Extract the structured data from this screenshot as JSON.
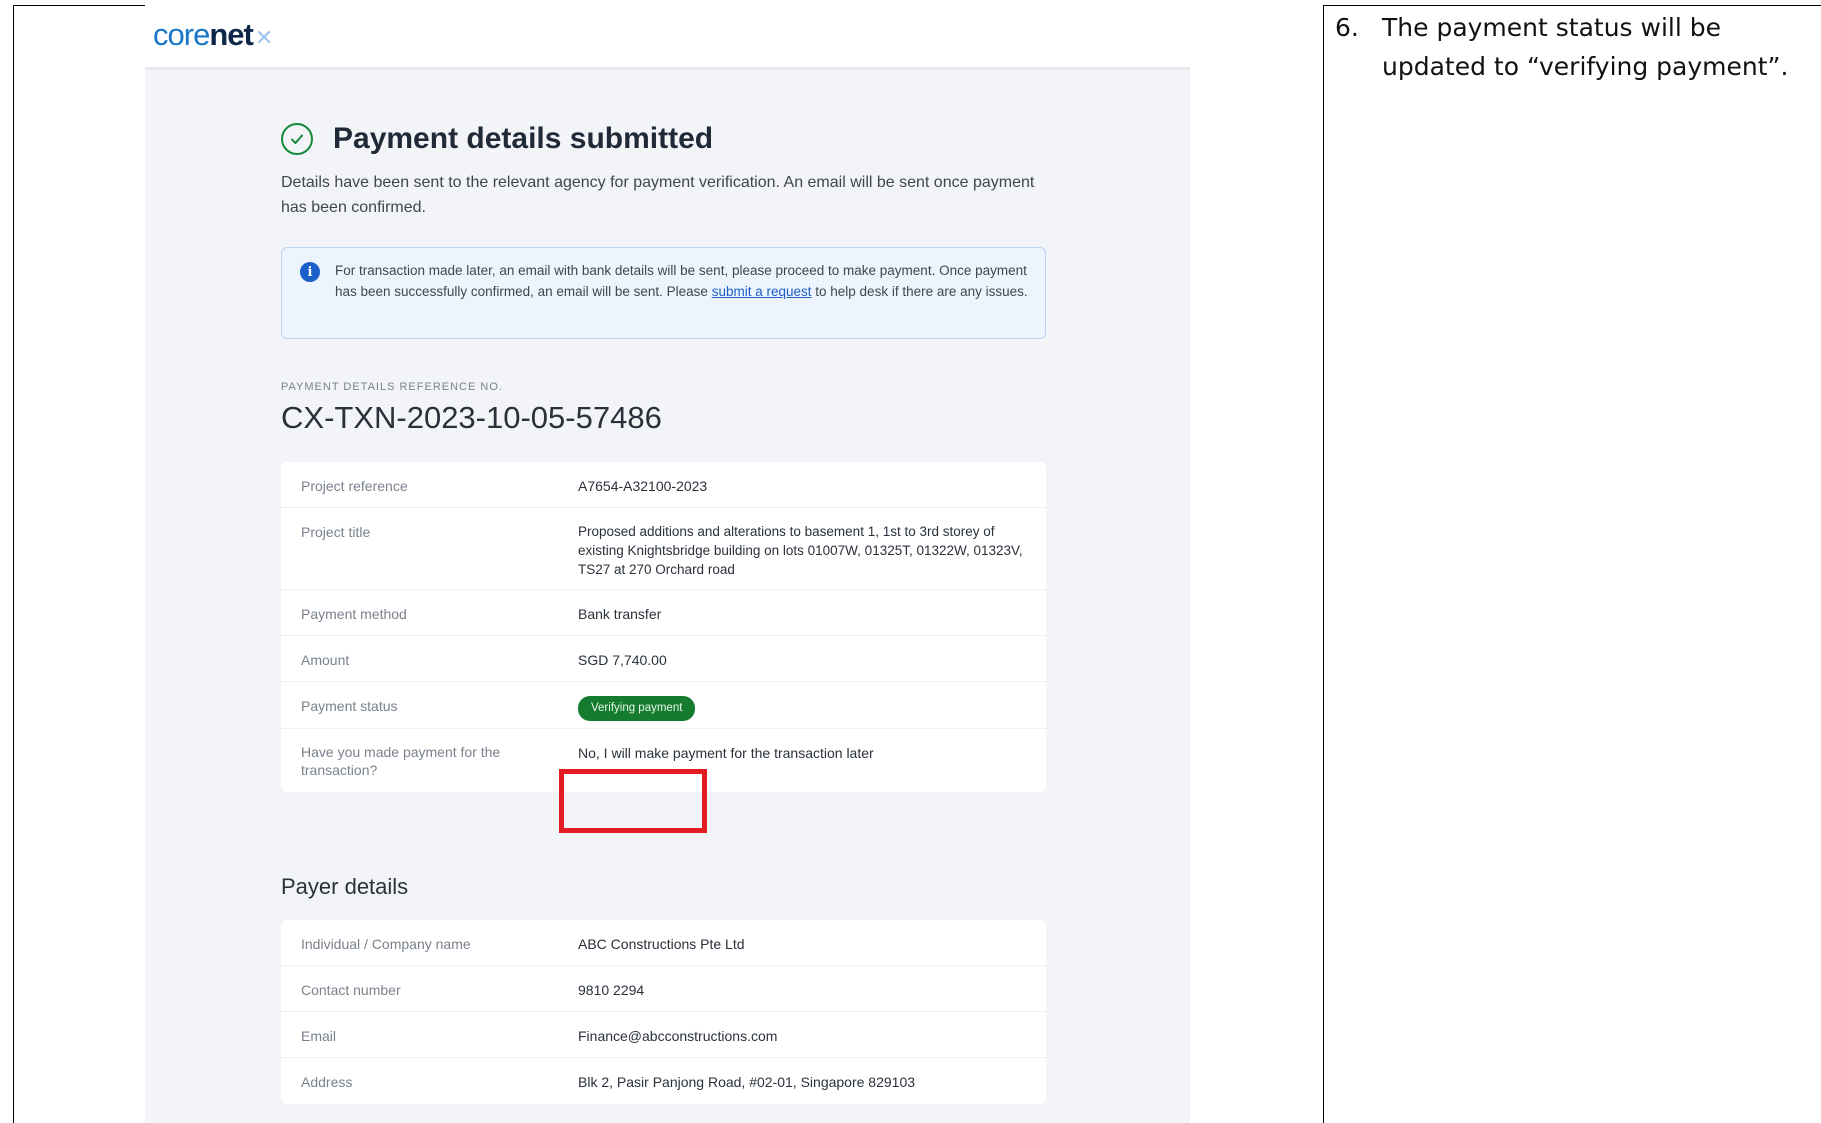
{
  "app": {
    "logo_part1": "core",
    "logo_part2": "net",
    "logo_mark": "✕"
  },
  "confirmation": {
    "title": "Payment details submitted",
    "icon": "check-circle-icon",
    "description": "Details have been sent to the relevant agency for payment verification. An email will be sent once payment has been confirmed."
  },
  "info_banner": {
    "icon": "info-icon",
    "text_before": "For transaction made later, an email with bank details will be sent, please proceed to make payment. Once payment has been successfully confirmed, an email will be sent. Please ",
    "link_text": "submit a request",
    "text_after": " to help desk if there are any issues."
  },
  "reference": {
    "label": "PAYMENT DETAILS REFERENCE NO.",
    "number": "CX-TXN-2023-10-05-57486"
  },
  "project_details": [
    {
      "label": "Project reference",
      "value": "A7654-A32100-2023"
    },
    {
      "label": "Project title",
      "value": "Proposed additions and alterations to basement 1, 1st to 3rd storey of existing Knightsbridge building on lots 01007W, 01325T, 01322W, 01323V, TS27 at 270 Orchard road"
    },
    {
      "label": "Payment method",
      "value": "Bank transfer"
    },
    {
      "label": "Amount",
      "value": "SGD 7,740.00"
    },
    {
      "label": "Payment status",
      "value": "Verifying payment"
    },
    {
      "label": "Have you made payment for the transaction?",
      "value": "No, I will make payment for the transaction later"
    }
  ],
  "payer_section_title": "Payer details",
  "payer_details": [
    {
      "label": "Individual / Company name",
      "value": "ABC Constructions Pte Ltd"
    },
    {
      "label": "Contact number",
      "value": "9810 2294"
    },
    {
      "label": "Email",
      "value": "Finance@abcconstructions.com"
    },
    {
      "label": "Address",
      "value": "Blk 2, Pasir Panjong Road, #02-01, Singapore 829103"
    }
  ],
  "note": {
    "number": "6.",
    "text": "The payment status will be updated to “verifying payment”."
  },
  "colors": {
    "status_badge": "#157b2e",
    "highlight": "#e31b23",
    "link": "#1b5fc9"
  }
}
